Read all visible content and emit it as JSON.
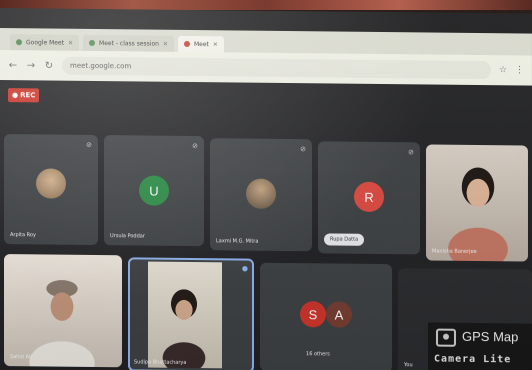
{
  "browser": {
    "tabs": [
      {
        "label": "Google Meet",
        "active": false
      },
      {
        "label": "Meet - class session",
        "active": false
      },
      {
        "label": "Meet",
        "active": true
      }
    ],
    "url": "meet.google.com"
  },
  "meeting": {
    "recording_badge": "REC",
    "participants": [
      {
        "name": "Arpita Roy",
        "kind": "photo-avatar",
        "color": "#8a6a4a"
      },
      {
        "name": "Ursula Poddar",
        "kind": "letter",
        "letter": "U",
        "color": "#1e8e3e"
      },
      {
        "name": "Laxmi M.G. Mitra",
        "kind": "photo-avatar",
        "color": "#6b5a46"
      },
      {
        "name": "Rupa Datta",
        "kind": "letter",
        "letter": "R",
        "color": "#e8453c",
        "pill": true
      },
      {
        "name": "Manisha Banerjee",
        "kind": "video"
      },
      {
        "name": "Sahid Ali",
        "kind": "video"
      },
      {
        "name": "Sudipa Bhattacharya",
        "kind": "video",
        "speaking": true
      },
      {
        "name": "16 others",
        "kind": "group",
        "letters": [
          "S",
          "A"
        ],
        "colors": [
          "#d93025",
          "#7a3b2e"
        ]
      },
      {
        "name": "You",
        "kind": "dark"
      }
    ]
  },
  "overlay": {
    "title": "GPS Map",
    "subtitle": "Camera Lite"
  },
  "colors": {
    "stage": "#202124",
    "tile": "#3c4043",
    "accent": "#8ab4f8",
    "rec": "#d93025"
  },
  "icons": {
    "mic_off": "mic-off-icon",
    "back": "arrow-left-icon",
    "forward": "arrow-right-icon",
    "reload": "reload-icon",
    "gps": "camera-icon"
  }
}
